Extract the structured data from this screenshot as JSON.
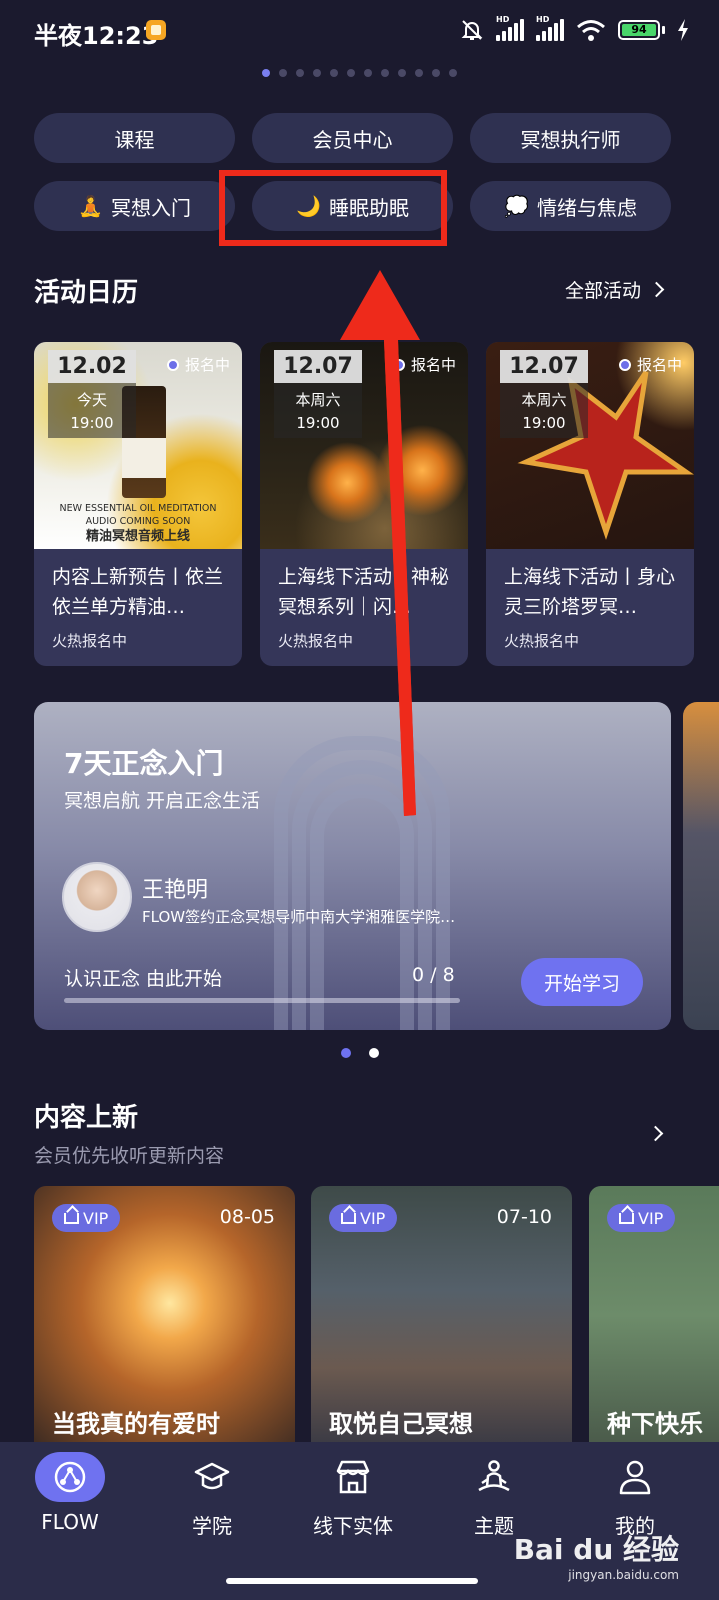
{
  "status_bar": {
    "time": "半夜12:23",
    "battery": "94",
    "hd_label": "HD"
  },
  "carousel_dots": {
    "count": 12,
    "active_index": 0
  },
  "quick_chips": [
    {
      "label": "课程",
      "emoji": ""
    },
    {
      "label": "会员中心",
      "emoji": ""
    },
    {
      "label": "冥想执行师",
      "emoji": ""
    },
    {
      "label": "冥想入门",
      "emoji": "🧘"
    },
    {
      "label": "睡眠助眠",
      "emoji": "🌙"
    },
    {
      "label": "情绪与焦虑",
      "emoji": "💭"
    }
  ],
  "activity_calendar": {
    "title": "活动日历",
    "more_label": "全部活动",
    "events": [
      {
        "date": "12.02",
        "day": "今天",
        "time": "19:00",
        "tag": "报名中",
        "poster_line1": "NEW ESSENTIAL OIL MEDITATION",
        "poster_line2": "AUDIO COMING SOON",
        "poster_line3": "精油冥想音频上线",
        "title": "内容上新预告丨依兰依兰单方精油…",
        "status": "火热报名中"
      },
      {
        "date": "12.07",
        "day": "本周六",
        "time": "19:00",
        "tag": "报名中",
        "title": "上海线下活动丨神秘冥想系列｜闪…",
        "status": "火热报名中"
      },
      {
        "date": "12.07",
        "day": "本周六",
        "time": "19:00",
        "tag": "报名中",
        "title": "上海线下活动丨身心灵三阶塔罗冥…",
        "status": "火热报名中"
      }
    ]
  },
  "course_banner": {
    "title": "7天正念入门",
    "subtitle": "冥想启航 开启正念生活",
    "teacher_name": "王艳明",
    "teacher_desc": "FLOW签约正念冥想导师中南大学湘雅医学院…",
    "lesson_label": "认识正念 由此开始",
    "progress_text": "0 / 8",
    "progress_fraction": 0,
    "button_label": "开始学习"
  },
  "banner_dots": {
    "count": 2,
    "active_index": 0
  },
  "new_content": {
    "title": "内容上新",
    "subtitle": "会员优先收听更新内容",
    "items": [
      {
        "badge": "VIP",
        "date": "08-05",
        "title": "当我真的有爱时"
      },
      {
        "badge": "VIP",
        "date": "07-10",
        "title": "取悦自己冥想"
      },
      {
        "badge": "VIP",
        "date": "",
        "title": "种下快乐"
      }
    ]
  },
  "tabbar": {
    "tabs": [
      {
        "label": "FLOW",
        "icon": "flow-logo-icon",
        "active": true
      },
      {
        "label": "学院",
        "icon": "graduation-cap-icon",
        "active": false
      },
      {
        "label": "线下实体",
        "icon": "storefront-icon",
        "active": false
      },
      {
        "label": "主题",
        "icon": "meditation-figure-icon",
        "active": false
      },
      {
        "label": "我的",
        "icon": "person-icon",
        "active": false
      }
    ]
  },
  "watermark": {
    "logo": "Bai du 经验",
    "url": "jingyan.baidu.com"
  },
  "colors": {
    "background": "#1b1a2e",
    "chip": "#2f3151",
    "accent": "#6f72f0",
    "annotation_red": "#ee2a1b"
  }
}
